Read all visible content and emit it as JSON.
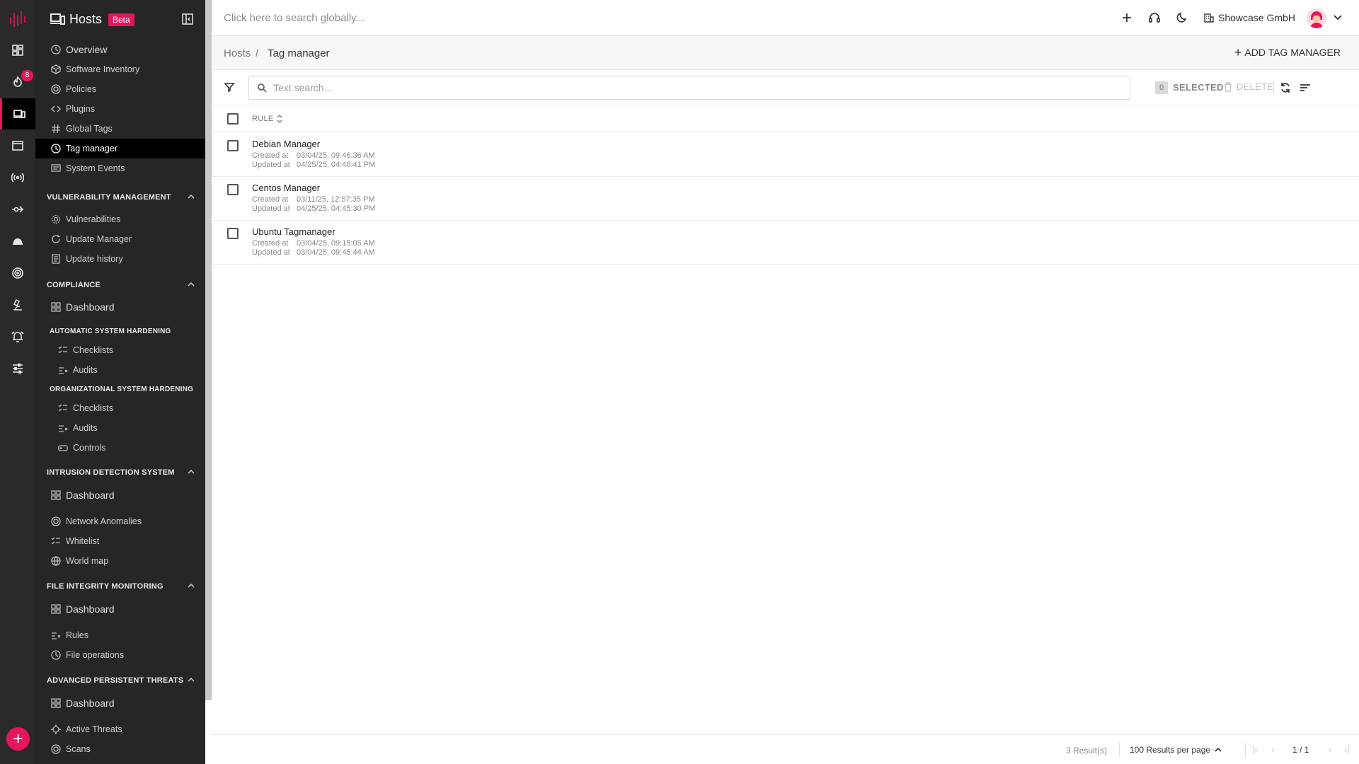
{
  "rail": {
    "notification_badge": "8",
    "items": [
      "dashboard-icon",
      "fire-icon",
      "hosts-icon",
      "window-icon",
      "broadcast-icon",
      "network-icon",
      "cloud-icon",
      "radar-icon",
      "microscope-icon",
      "alarm-icon",
      "sliders-icon"
    ],
    "active_index": 2
  },
  "sidebar": {
    "title": "Hosts",
    "badge": "Beta",
    "items": {
      "overview": "Overview",
      "software_inventory": "Software Inventory",
      "policies": "Policies",
      "plugins": "Plugins",
      "global_tags": "Global Tags",
      "tag_manager": "Tag manager",
      "system_events": "System Events"
    },
    "vuln": {
      "header": "VULNERABILITY MANAGEMENT",
      "vulnerabilities": "Vulnerabilities",
      "update_manager": "Update Manager",
      "update_history": "Update history"
    },
    "compliance": {
      "header": "COMPLIANCE",
      "dashboard": "Dashboard",
      "auto_header": "AUTOMATIC SYSTEM HARDENING",
      "auto_checklists": "Checklists",
      "auto_audits": "Audits",
      "org_header": "ORGANIZATIONAL SYSTEM HARDENING",
      "org_checklists": "Checklists",
      "org_audits": "Audits",
      "org_controls": "Controls"
    },
    "ids": {
      "header": "INTRUSION DETECTION SYSTEM",
      "dashboard": "Dashboard",
      "network_anomalies": "Network Anomalies",
      "whitelist": "Whitelist",
      "world_map": "World map"
    },
    "fim": {
      "header": "FILE INTEGRITY MONITORING",
      "dashboard": "Dashboard",
      "rules": "Rules",
      "file_operations": "File operations"
    },
    "apt": {
      "header": "ADVANCED PERSISTENT THREATS",
      "dashboard": "Dashboard",
      "active_threats": "Active Threats",
      "scans": "Scans"
    }
  },
  "topbar": {
    "search_placeholder": "Click here to search globally...",
    "organization": "Showcase GmbH"
  },
  "breadcrumb": {
    "parent": "Hosts",
    "separator": "/",
    "current": "Tag manager",
    "add_button": "ADD TAG MANAGER"
  },
  "toolbar": {
    "search_placeholder": "Text search...",
    "selected_count": "0",
    "selected_label": "SELECTED",
    "delete_label": "DELETE"
  },
  "table": {
    "column": "RULE",
    "created_label": "Created at",
    "updated_label": "Updated at",
    "rows": [
      {
        "name": "Debian Manager",
        "created": "03/04/25, 09:46:36 AM",
        "updated": "04/25/25, 04:46:41 PM"
      },
      {
        "name": "Centos Manager",
        "created": "03/11/25, 12:57:35 PM",
        "updated": "04/25/25, 04:45:30 PM"
      },
      {
        "name": "Ubuntu Tagmanager",
        "created": "03/04/25, 09:15:05 AM",
        "updated": "03/04/25, 09:45:44 AM"
      }
    ]
  },
  "footer": {
    "results": "3 Result(s)",
    "per_page": "100 Results per page",
    "page": "1 / 1"
  },
  "colors": {
    "accent": "#e6155f",
    "sidebar_bg": "#262626",
    "rail_bg": "#2a2a2a"
  }
}
